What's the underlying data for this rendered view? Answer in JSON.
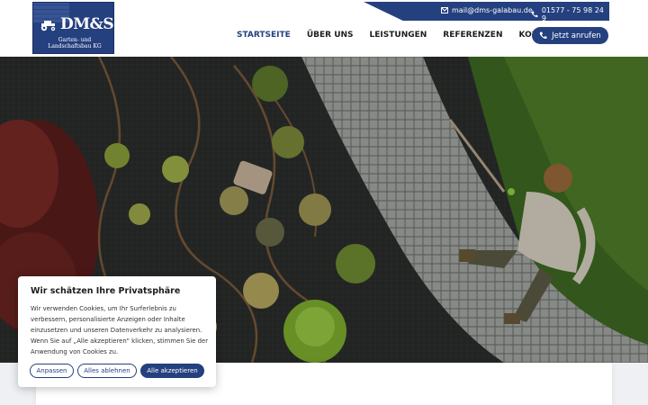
{
  "logo": {
    "brand": "DM&S",
    "tagline": "Garten- und Landschaftsbau KG",
    "icon": "tractor-icon"
  },
  "topbar": {
    "email": "mail@dms-galabau.de",
    "email_icon": "mail-icon",
    "phone": "01577 - 75 98 24 9",
    "phone_icon": "phone-icon"
  },
  "nav": {
    "items": [
      "STARTSEITE",
      "ÜBER UNS",
      "LEISTUNGEN",
      "REFERENZEN",
      "KONTAKT"
    ],
    "active_index": 0
  },
  "cta": {
    "label": "Jetzt anrufen",
    "icon": "phone-icon"
  },
  "cookie": {
    "title": "Wir schätzen Ihre Privatsphäre",
    "text": "Wir verwenden Cookies, um Ihr Surferlebnis zu verbessern, personalisierte Anzeigen oder Inhalte einzusetzen und unseren Datenverkehr zu analysieren. Wenn Sie auf „Alle akzeptieren\" klicken, stimmen Sie der Anwendung von Cookies zu.",
    "customize_label": "Anpassen",
    "reject_label": "Alles ablehnen",
    "accept_label": "Alle akzeptieren"
  },
  "colors": {
    "brand": "#25407f",
    "white": "#ffffff"
  }
}
